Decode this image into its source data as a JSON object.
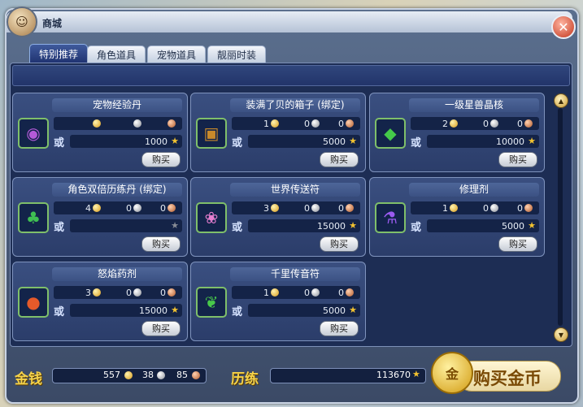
{
  "window": {
    "title": "商城",
    "close_icon": "✕"
  },
  "tabs": [
    {
      "label": "特别推荐",
      "active": true
    },
    {
      "label": "角色道具",
      "active": false
    },
    {
      "label": "宠物道具",
      "active": false
    },
    {
      "label": "靓丽时装",
      "active": false
    }
  ],
  "items": [
    {
      "name": "宠物经验丹",
      "icon": "purple-orb-icon",
      "icon_glyph": "◉",
      "icon_color": "#b45ad8",
      "gold": "",
      "silver": "",
      "copper": "",
      "or": "或",
      "exp": "1000",
      "exp_available": true,
      "buy": "购买"
    },
    {
      "name": "装满了贝的箱子 (绑定)",
      "icon": "treasure-chest-icon",
      "icon_glyph": "▣",
      "icon_color": "#c98a2a",
      "gold": "1",
      "silver": "0",
      "copper": "0",
      "or": "或",
      "exp": "5000",
      "exp_available": true,
      "buy": "购买"
    },
    {
      "name": "一级星兽晶核",
      "icon": "green-crystal-icon",
      "icon_glyph": "◆",
      "icon_color": "#45c94a",
      "gold": "2",
      "silver": "0",
      "copper": "0",
      "or": "或",
      "exp": "10000",
      "exp_available": true,
      "buy": "购买"
    },
    {
      "name": "角色双倍历练丹 (绑定)",
      "icon": "green-leaf-icon",
      "icon_glyph": "♣",
      "icon_color": "#3fbf52",
      "gold": "4",
      "silver": "0",
      "copper": "0",
      "or": "或",
      "exp": "",
      "exp_available": false,
      "buy": "购买"
    },
    {
      "name": "世界传送符",
      "icon": "pink-scroll-icon",
      "icon_glyph": "❀",
      "icon_color": "#e77fd0",
      "gold": "3",
      "silver": "0",
      "copper": "0",
      "or": "或",
      "exp": "15000",
      "exp_available": true,
      "buy": "购买"
    },
    {
      "name": "修理剂",
      "icon": "purple-potion-icon",
      "icon_glyph": "⚗",
      "icon_color": "#9b5bf0",
      "gold": "1",
      "silver": "0",
      "copper": "0",
      "or": "或",
      "exp": "5000",
      "exp_available": true,
      "buy": "购买"
    },
    {
      "name": "怒焰药剂",
      "icon": "red-orb-icon",
      "icon_glyph": "●",
      "icon_color": "#e55a2a",
      "gold": "3",
      "silver": "0",
      "copper": "0",
      "or": "或",
      "exp": "15000",
      "exp_available": true,
      "buy": "购买"
    },
    {
      "name": "千里传音符",
      "icon": "green-note-icon",
      "icon_glyph": "❦",
      "icon_color": "#48c84a",
      "gold": "1",
      "silver": "0",
      "copper": "0",
      "or": "或",
      "exp": "5000",
      "exp_available": true,
      "buy": "购买"
    }
  ],
  "footer": {
    "money_label": "金钱",
    "money_gold": "557",
    "money_silver": "38",
    "money_copper": "85",
    "exp_label": "历练",
    "exp_value": "113670",
    "buy_gold_label": "购买金币",
    "buy_gold_coin": "金"
  },
  "colors": {
    "gold": "#d89a18",
    "silver": "#8c9099",
    "copper": "#b25a2a",
    "panel": "#1d2d54"
  }
}
